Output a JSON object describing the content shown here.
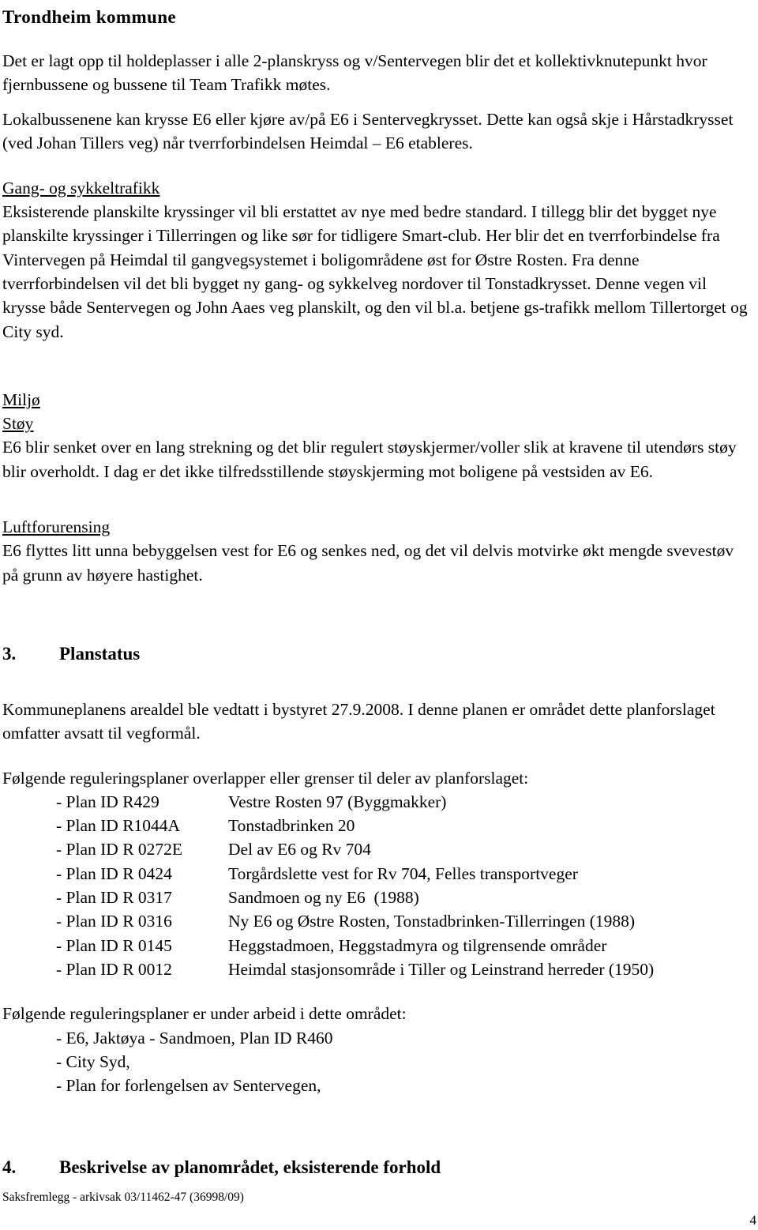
{
  "document": {
    "title": "Trondheim kommune",
    "paragraphs": {
      "p1": "Det er lagt opp til holdeplasser i alle 2-planskryss og v/Sentervegen blir det et kollektivknutepunkt hvor fjernbussene og bussene til Team Trafikk møtes.",
      "p2": "Lokalbussenene kan krysse E6 eller kjøre av/på E6 i Sentervegkrysset. Dette kan også skje i Hårstadkrysset (ved Johan Tillers veg) når tverrforbindelsen Heimdal – E6 etableres.",
      "gang_heading": "Gang- og sykkeltrafikk",
      "gang_body": "Eksisterende planskilte kryssinger vil bli erstattet av nye med bedre standard. I tillegg blir det bygget nye planskilte kryssinger i Tillerringen og like sør for tidligere Smart-club. Her blir det en tverrforbindelse fra Vintervegen på Heimdal til gangvegsystemet i boligområdene øst for Østre Rosten.  Fra denne tverrforbindelsen vil det bli bygget ny gang- og sykkelveg nordover til Tonstadkrysset. Denne vegen vil krysse både Sentervegen og John Aaes veg planskilt, og den vil bl.a. betjene gs-trafikk mellom Tillertorget og City syd.",
      "miljo_heading": "Miljø",
      "stoy_heading": "Støy",
      "stoy_body": "E6 blir senket over en lang strekning og det blir regulert støyskjermer/voller slik at kravene til utendørs støy blir overholdt. I dag er det ikke tilfredsstillende støyskjerming mot boligene på vestsiden av E6.",
      "luft_heading": "Luftforurensing",
      "luft_body": "E6 flyttes litt unna bebyggelsen vest for E6 og senkes ned, og det vil delvis motvirke økt mengde svevestøv på grunn av høyere hastighet."
    },
    "section3": {
      "number": "3.",
      "title": "Planstatus",
      "intro": "Kommuneplanens arealdel ble vedtatt i bystyret 27.9.2008. I denne planen er området dette planforslaget omfatter avsatt til vegformål.",
      "list_intro": "Følgende reguleringsplaner overlapper eller grenser til deler av planforslaget:",
      "plans": [
        {
          "id": "- Plan ID R429",
          "desc": "Vestre Rosten 97 (Byggmakker)"
        },
        {
          "id": "- Plan ID R1044A",
          "desc": "Tonstadbrinken 20"
        },
        {
          "id": "- Plan ID R 0272E",
          "desc": "Del av E6 og Rv 704"
        },
        {
          "id": "- Plan ID R 0424",
          "desc": "Torgårdslette vest for Rv 704, Felles transportveger"
        },
        {
          "id": "- Plan ID R 0317",
          "desc": "Sandmoen og ny E6  (1988)"
        },
        {
          "id": "- Plan ID R 0316",
          "desc": "Ny E6 og Østre Rosten, Tonstadbrinken-Tillerringen (1988)"
        },
        {
          "id": "- Plan ID R 0145",
          "desc": "Heggstadmoen, Heggstadmyra og tilgrensende områder"
        },
        {
          "id": "- Plan ID R 0012",
          "desc": "Heimdal stasjonsområde i Tiller og Leinstrand herreder (1950)"
        }
      ],
      "wip_intro": "Følgende reguleringsplaner er under arbeid i dette området:",
      "wip": [
        "- E6, Jaktøya - Sandmoen, Plan ID R460",
        "- City Syd,",
        "- Plan for forlengelsen av Sentervegen,"
      ]
    },
    "section4": {
      "number": "4.",
      "title": "Beskrivelse av planområdet, eksisterende forhold"
    },
    "footer": {
      "text": "Saksfremlegg - arkivsak  03/11462-47 (36998/09)",
      "page_number": "4"
    }
  }
}
